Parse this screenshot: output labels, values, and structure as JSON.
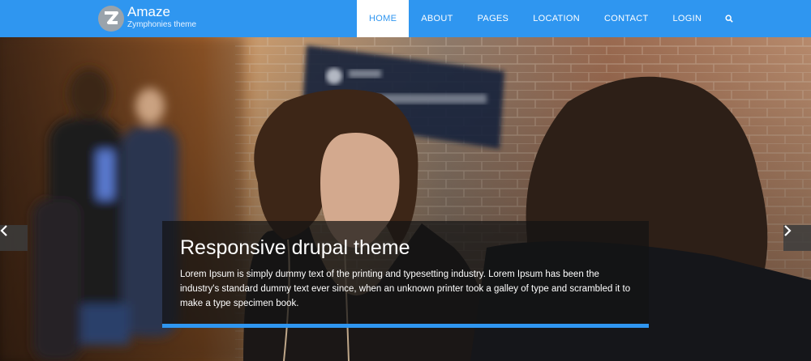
{
  "site": {
    "name": "Amaze",
    "tagline": "Zymphonies theme"
  },
  "nav": {
    "items": [
      {
        "label": "HOME",
        "active": true
      },
      {
        "label": "ABOUT"
      },
      {
        "label": "PAGES"
      },
      {
        "label": "LOCATION"
      },
      {
        "label": "CONTACT"
      },
      {
        "label": "LOGIN"
      }
    ],
    "search_icon": "search-icon"
  },
  "slider": {
    "prev_icon": "chevron-left-icon",
    "next_icon": "chevron-right-icon",
    "caption": {
      "title": "Responsive drupal theme",
      "text": "Lorem Ipsum is simply dummy text of the printing and typesetting industry. Lorem Ipsum has been the industry's standard dummy text ever since, when an unknown printer took a galley of type and scrambled it to make a type specimen book."
    }
  },
  "colors": {
    "brand": "#2f96f0",
    "caption_bg": "#141414"
  }
}
